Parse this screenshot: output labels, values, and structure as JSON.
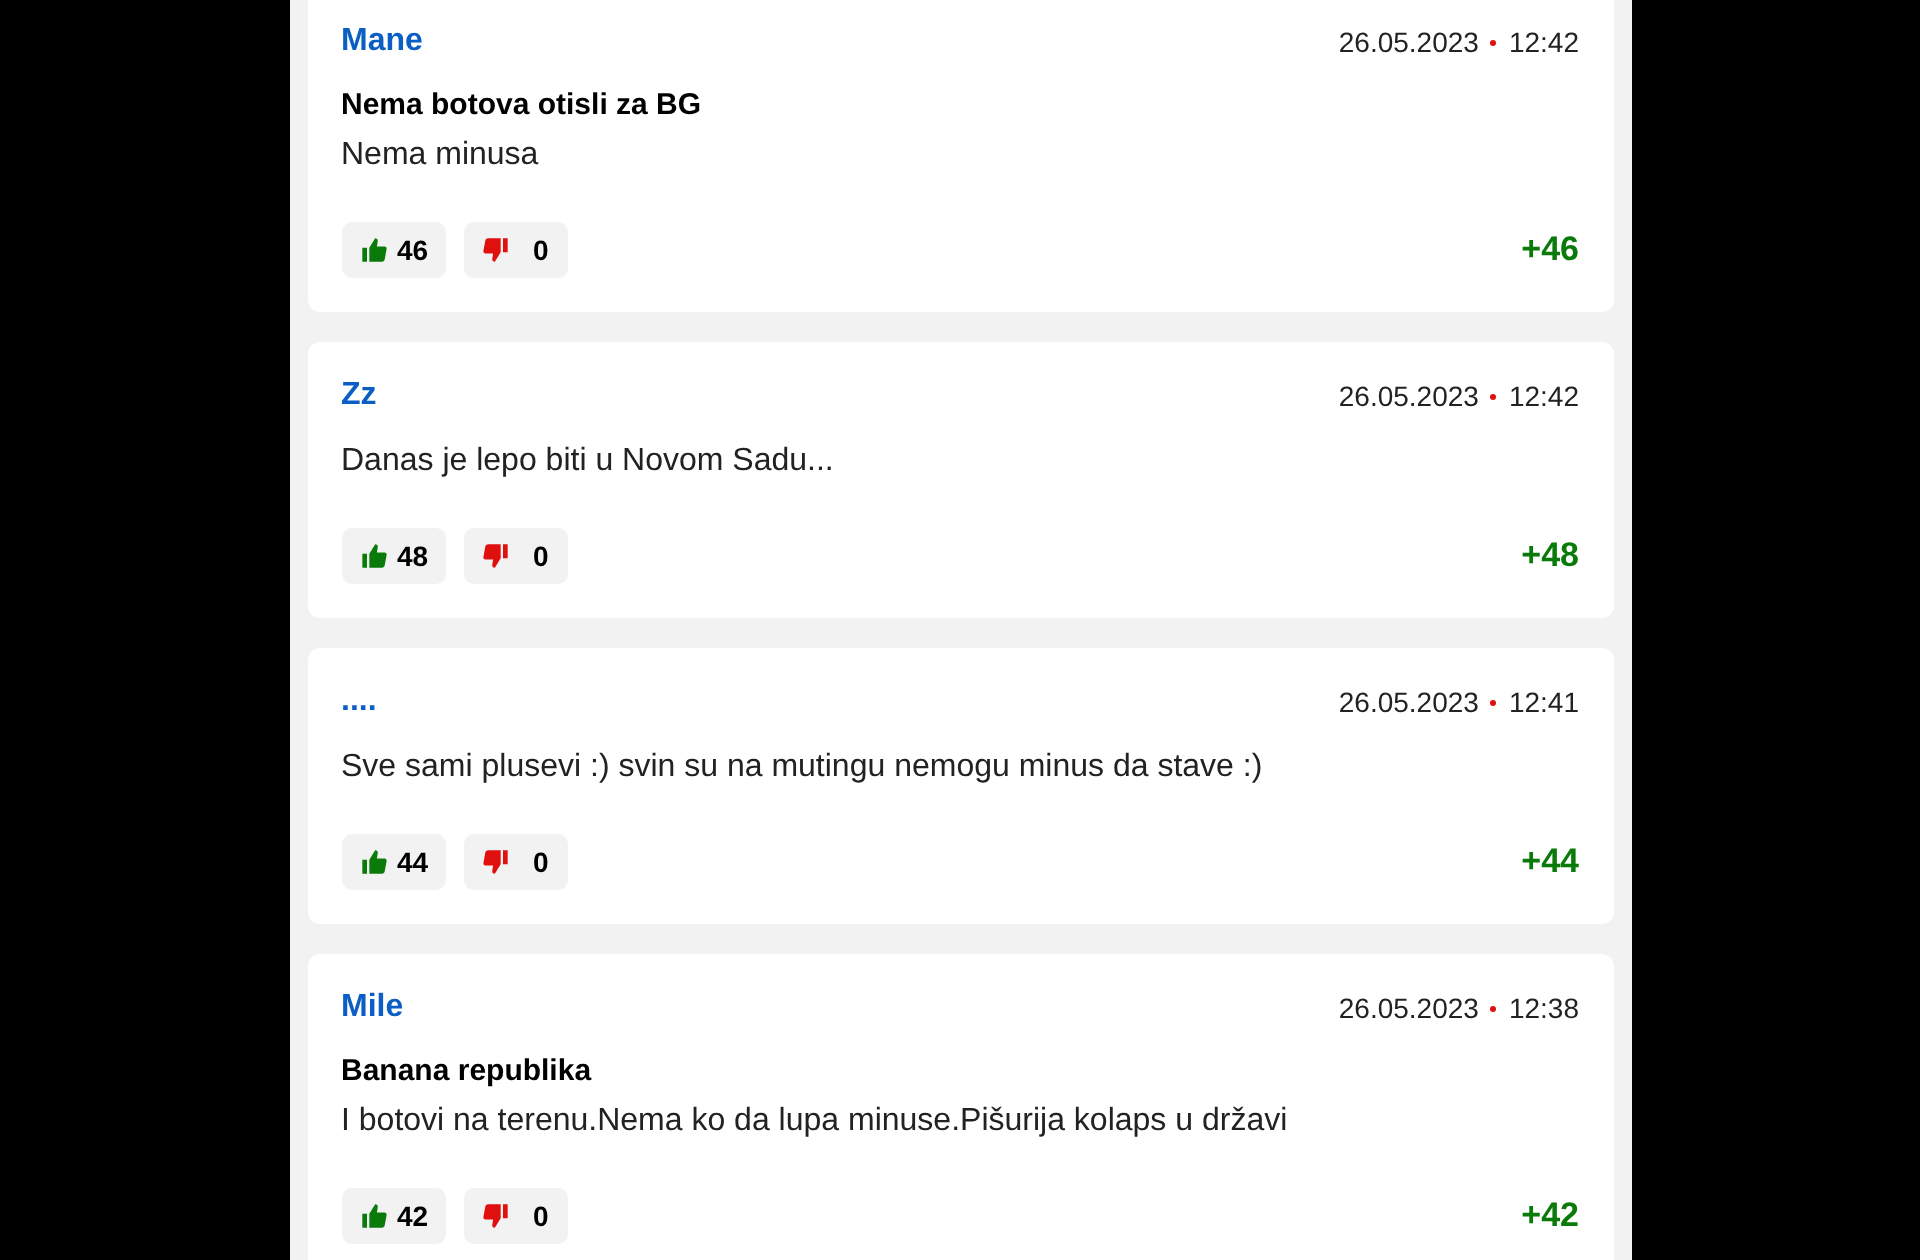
{
  "comments": [
    {
      "author": "Mane",
      "date": "26.05.2023",
      "time": "12:42",
      "title": "Nema botova otisli za BG",
      "text": "Nema minusa",
      "likes": "46",
      "dislikes": "0",
      "score": "+46"
    },
    {
      "author": "Zz",
      "date": "26.05.2023",
      "time": "12:42",
      "text": "Danas je lepo biti u Novom Sadu...",
      "likes": "48",
      "dislikes": "0",
      "score": "+48"
    },
    {
      "author": "....",
      "date": "26.05.2023",
      "time": "12:41",
      "text": "Sve sami plusevi :) svin su na mutingu nemogu minus da stave :)",
      "likes": "44",
      "dislikes": "0",
      "score": "+44"
    },
    {
      "author": "Mile",
      "date": "26.05.2023",
      "time": "12:38",
      "title": "Banana republika",
      "text": "I botovi na terenu.Nema ko da lupa minuse.Pišurija kolaps u državi",
      "likes": "42",
      "dislikes": "0",
      "score": "+42"
    }
  ]
}
